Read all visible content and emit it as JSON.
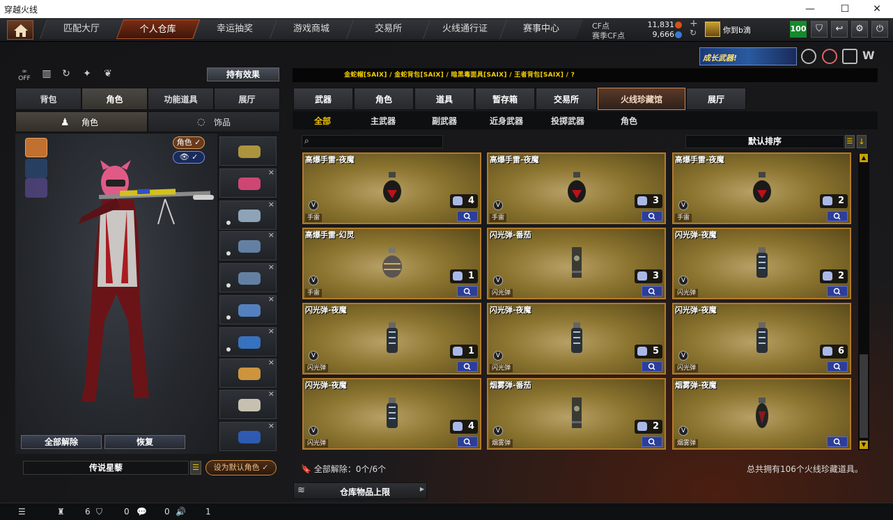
{
  "window": {
    "title": "穿越火线"
  },
  "nav": {
    "tabs": [
      "匹配大厅",
      "个人仓库",
      "幸运抽奖",
      "游戏商城",
      "交易所",
      "火线通行证",
      "赛事中心"
    ],
    "active": "个人仓库"
  },
  "currency": {
    "cf_label": "CF点",
    "cf_value": "11,831",
    "match_label": "赛季CF点",
    "match_value": "9,666"
  },
  "user": {
    "name": "你到b滴",
    "level": "100"
  },
  "promo": {
    "banner_text": "成长武器!"
  },
  "left": {
    "hold_effect_button": "持有效果",
    "tabs": [
      "背包",
      "角色",
      "功能道具",
      "展厅"
    ],
    "active_tab": "角色",
    "sub_tabs": [
      "角色",
      "饰品"
    ],
    "role_toggle": "角色",
    "unequip_all_button": "全部解除",
    "restore_button": "恢复",
    "character_name": "传说星藜",
    "set_default_button": "设为默认角色",
    "off_label": "OFF"
  },
  "right": {
    "breadcrumb": "金蛇帽[SAIX] / 金蛇背包[SAIX] / 暗黑毒面具[SAIX] / 王者背包[SAIX] / ?",
    "tabs": [
      "武器",
      "角色",
      "道具",
      "暂存箱",
      "交易所",
      "火线珍藏馆",
      "展厅"
    ],
    "active_tab": "火线珍藏馆",
    "sub_tabs": [
      "全部",
      "主武器",
      "副武器",
      "近身武器",
      "投掷武器",
      "角色"
    ],
    "active_sub": "全部",
    "sort_label": "默认排序",
    "items": [
      {
        "name": "高爆手雷-夜魔",
        "count": "4",
        "tag": "手雷",
        "kind": "grenade"
      },
      {
        "name": "高爆手雷-夜魔",
        "count": "3",
        "tag": "手雷",
        "kind": "grenade"
      },
      {
        "name": "高爆手雷-夜魔",
        "count": "2",
        "tag": "手雷",
        "kind": "grenade"
      },
      {
        "name": "高爆手雷-幻灵",
        "count": "1",
        "tag": "手雷",
        "kind": "grenade-gold"
      },
      {
        "name": "闪光弹-番茄",
        "count": "3",
        "tag": "闪光弹",
        "kind": "can"
      },
      {
        "name": "闪光弹-夜魔",
        "count": "2",
        "tag": "闪光弹",
        "kind": "flash"
      },
      {
        "name": "闪光弹-夜魔",
        "count": "1",
        "tag": "闪光弹",
        "kind": "flash"
      },
      {
        "name": "闪光弹-夜魔",
        "count": "5",
        "tag": "闪光弹",
        "kind": "flash"
      },
      {
        "name": "闪光弹-夜魔",
        "count": "6",
        "tag": "闪光弹",
        "kind": "flash"
      },
      {
        "name": "闪光弹-夜魔",
        "count": "4",
        "tag": "闪光弹",
        "kind": "flash"
      },
      {
        "name": "烟雾弹-番茄",
        "count": "2",
        "tag": "烟雾弹",
        "kind": "can"
      },
      {
        "name": "烟雾弹-夜魔",
        "count": "",
        "tag": "烟雾弹",
        "kind": "smoke"
      }
    ],
    "unequip_status": "全部解除：0个/6个",
    "total_text": "总共拥有106个火线珍藏道具。",
    "storage_label": "仓库物品上限"
  },
  "statusbar": {
    "friends": "6",
    "shield": "0",
    "chat": "0",
    "volume": "1"
  }
}
